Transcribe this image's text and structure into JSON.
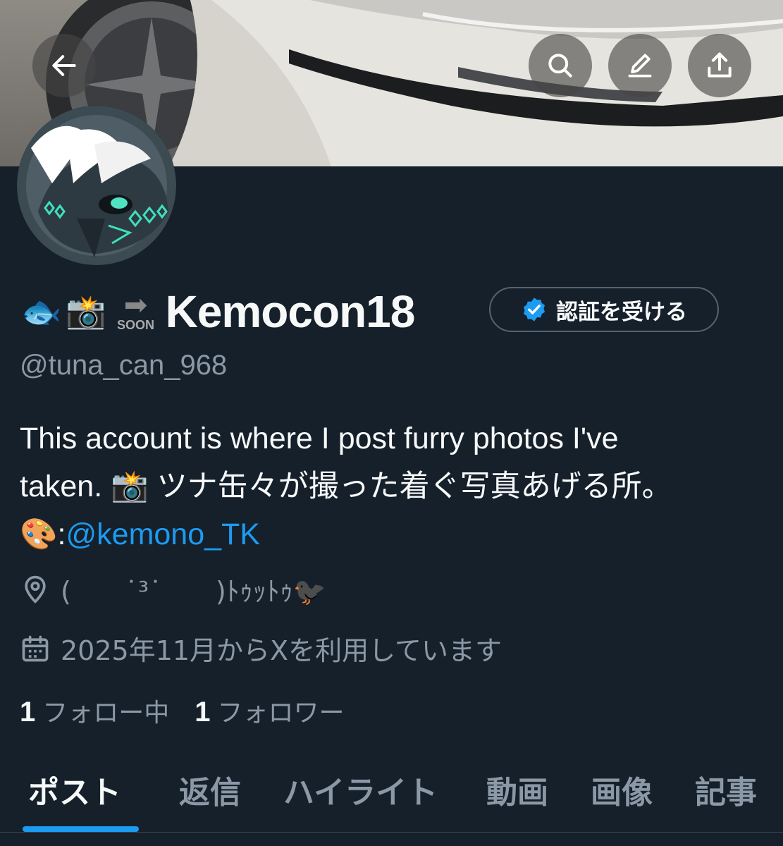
{
  "header": {
    "back_icon": "arrow-left-icon",
    "actions": [
      "search-icon",
      "edit-icon",
      "share-icon"
    ]
  },
  "profile": {
    "name_emojis": [
      "🐟",
      "📸",
      "🔜"
    ],
    "name_soon_arrow": "➡",
    "name_soon_text": "SOON",
    "display_name": "Kemocon18",
    "verify_label": "認証を受ける",
    "handle": "@tuna_can_968",
    "bio_line1": "This account is where I post furry photos I've",
    "bio_line2_pre": "taken. ",
    "bio_camera": "📸",
    "bio_line2_post": " ツナ缶々が撮った着ぐ写真あげる所。",
    "bio_palette": "🎨",
    "bio_colon": ":",
    "bio_mention": "@kemono_TK",
    "location": "(　　˙³˙　　)ﾄｩｯﾄｩ🐦‍⬛",
    "joined": "2025年11月からXを利用しています",
    "following_count": "1",
    "following_label": "フォロー中",
    "followers_count": "1",
    "followers_label": "フォロワー"
  },
  "tabs": [
    "ポスト",
    "返信",
    "ハイライト",
    "動画",
    "画像",
    "記事"
  ],
  "colors": {
    "background": "#15202b",
    "accent": "#1d9bf0",
    "muted_text": "#8b98a5",
    "border": "#536471"
  }
}
